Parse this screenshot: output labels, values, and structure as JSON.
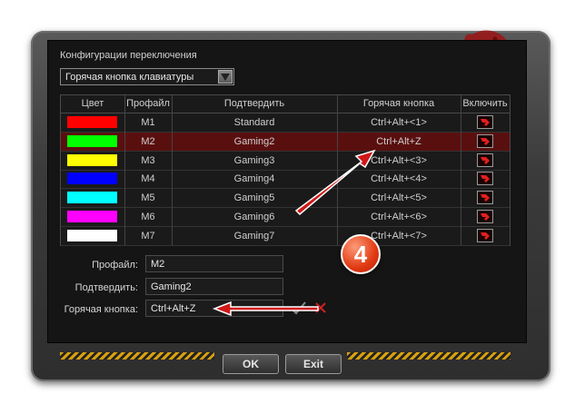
{
  "dialog": {
    "group_title": "Конфигурации переключения",
    "select_value": "Горячая кнопка клавиатуры"
  },
  "table": {
    "headers": [
      "Цвет",
      "Профайл",
      "Подтвердить",
      "Горячая кнопка",
      "Включить"
    ],
    "rows": [
      {
        "color": "#ff0000",
        "profile": "M1",
        "confirm": "Standard",
        "hotkey": "Ctrl+Alt+<1>"
      },
      {
        "color": "#00ff00",
        "profile": "M2",
        "confirm": "Gaming2",
        "hotkey": "Ctrl+Alt+Z"
      },
      {
        "color": "#ffff00",
        "profile": "M3",
        "confirm": "Gaming3",
        "hotkey": "Ctrl+Alt+<3>"
      },
      {
        "color": "#0000ff",
        "profile": "M4",
        "confirm": "Gaming4",
        "hotkey": "Ctrl+Alt+<4>"
      },
      {
        "color": "#00ffff",
        "profile": "M5",
        "confirm": "Gaming5",
        "hotkey": "Ctrl+Alt+<5>"
      },
      {
        "color": "#ff00ff",
        "profile": "M6",
        "confirm": "Gaming6",
        "hotkey": "Ctrl+Alt+<6>"
      },
      {
        "color": "#ffffff",
        "profile": "M7",
        "confirm": "Gaming7",
        "hotkey": "Ctrl+Alt+<7>"
      }
    ],
    "selected_row": 1
  },
  "form": {
    "profile_label": "Профайл:",
    "profile_value": "M2",
    "confirm_label": "Подтвердить:",
    "confirm_value": "Gaming2",
    "hotkey_label": "Горячая кнопка:",
    "hotkey_value": "Ctrl+Alt+Z"
  },
  "buttons": {
    "ok": "OK",
    "exit": "Exit"
  },
  "annotation": {
    "step_number": "4",
    "arrow_color": "#d01818"
  }
}
